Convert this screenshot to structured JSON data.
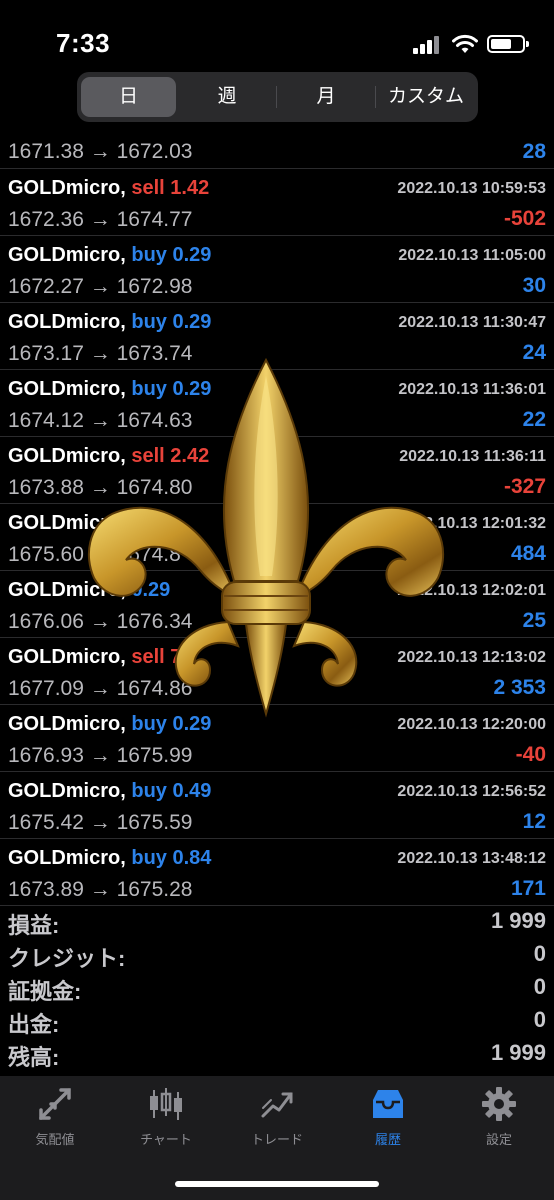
{
  "status_bar": {
    "time": "7:33"
  },
  "segments": [
    "日",
    "週",
    "月",
    "カスタム"
  ],
  "selected_segment": "日",
  "trades_partial": {
    "prices": "1671.38 → 1672.03",
    "profit": "28"
  },
  "trades": [
    {
      "symbol": "GOLDmicro,",
      "side": "sell",
      "volume": "1.42",
      "datetime": "2022.10.13 10:59:53",
      "prices": "1672.36 → 1674.77",
      "profit": "-502"
    },
    {
      "symbol": "GOLDmicro,",
      "side": "buy",
      "volume": "0.29",
      "datetime": "2022.10.13 11:05:00",
      "prices": "1672.27 → 1672.98",
      "profit": "30"
    },
    {
      "symbol": "GOLDmicro,",
      "side": "buy",
      "volume": "0.29",
      "datetime": "2022.10.13 11:30:47",
      "prices": "1673.17 → 1673.74",
      "profit": "24"
    },
    {
      "symbol": "GOLDmicro,",
      "side": "buy",
      "volume": "0.29",
      "datetime": "2022.10.13 11:36:01",
      "prices": "1674.12 → 1674.63",
      "profit": "22"
    },
    {
      "symbol": "GOLDmicro,",
      "side": "sell",
      "volume": "2.42",
      "datetime": "2022.10.13 11:36:11",
      "prices": "1673.88 → 1674.80",
      "profit": "-327"
    },
    {
      "symbol": "GOLDmicro,",
      "side": "",
      "volume": "",
      "datetime": "2022.10.13 12:01:32",
      "prices": "1675.60 → 1674.8",
      "profit": "484"
    },
    {
      "symbol": "GOLDmicro,",
      "side": "",
      "volume": "0.29",
      "datetime": "2022.10.13 12:02:01",
      "prices": "1676.06 → 1676.34",
      "profit": "25"
    },
    {
      "symbol": "GOLDmicro,",
      "side": "sell",
      "volume": "7",
      "datetime": "2022.10.13 12:13:02",
      "prices": "1677.09 → 1674.86",
      "profit": "2 353"
    },
    {
      "symbol": "GOLDmicro,",
      "side": "buy",
      "volume": "0.29",
      "datetime": "2022.10.13 12:20:00",
      "prices": "1676.93 → 1675.99",
      "profit": "-40"
    },
    {
      "symbol": "GOLDmicro,",
      "side": "buy",
      "volume": "0.49",
      "datetime": "2022.10.13 12:56:52",
      "prices": "1675.42 → 1675.59",
      "profit": "12"
    },
    {
      "symbol": "GOLDmicro,",
      "side": "buy",
      "volume": "0.84",
      "datetime": "2022.10.13 13:48:12",
      "prices": "1673.89 → 1675.28",
      "profit": "171"
    }
  ],
  "summary": [
    {
      "label": "損益:",
      "value": "1 999"
    },
    {
      "label": "クレジット:",
      "value": "0"
    },
    {
      "label": "証拠金:",
      "value": "0"
    },
    {
      "label": "出金:",
      "value": "0"
    },
    {
      "label": "残高:",
      "value": "1 999"
    }
  ],
  "tabs": [
    {
      "label": "気配値",
      "icon": "quotes-arrows-icon"
    },
    {
      "label": "チャート",
      "icon": "candlestick-chart-icon"
    },
    {
      "label": "トレード",
      "icon": "trade-trend-icon"
    },
    {
      "label": "履歴",
      "icon": "inbox-tray-icon"
    },
    {
      "label": "設定",
      "icon": "gear-icon"
    }
  ],
  "active_tab": "履歴",
  "colors": {
    "buy": "#2d83ea",
    "sell": "#e8433a",
    "active_tab": "#2d83ea",
    "background": "#000000"
  }
}
